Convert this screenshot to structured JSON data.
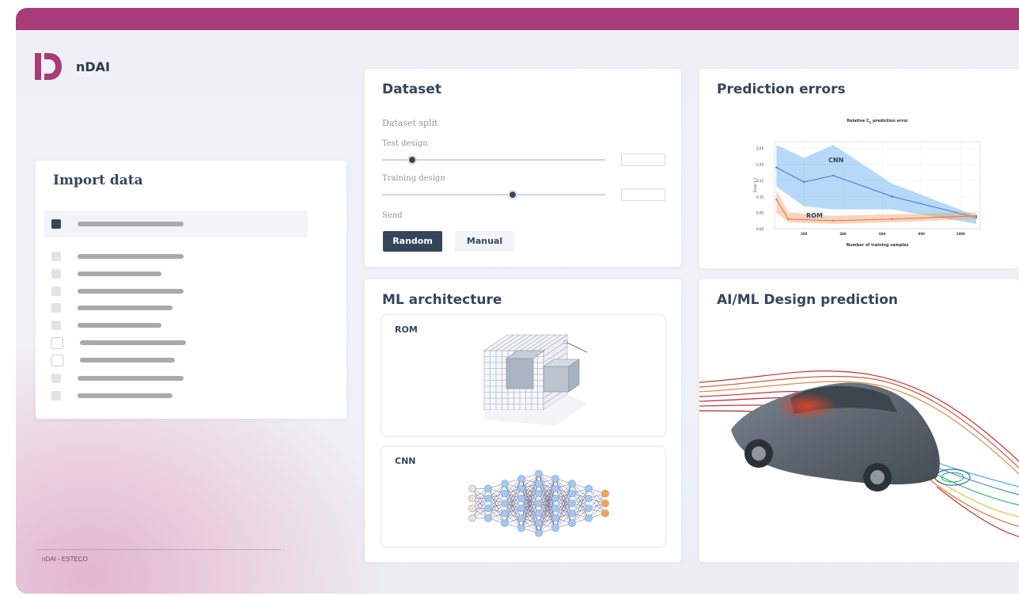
{
  "app": {
    "name": "nDAI",
    "footer": "nDAI - ESTECO"
  },
  "colors": {
    "accent_bar": "#a93b79",
    "primary": "#34465a",
    "cnn_series": "#3f78c4",
    "rom_series": "#e07a3c"
  },
  "import_data": {
    "title": "Import data",
    "items": [
      {
        "state": "checked",
        "bar": 134
      },
      {
        "state": "light",
        "bar": 134
      },
      {
        "state": "light",
        "bar": 106
      },
      {
        "state": "light",
        "bar": 134
      },
      {
        "state": "light",
        "bar": 120
      },
      {
        "state": "light",
        "bar": 106
      },
      {
        "state": "empty",
        "bar": 134
      },
      {
        "state": "empty",
        "bar": 120
      },
      {
        "state": "light",
        "bar": 134
      },
      {
        "state": "light",
        "bar": 120
      }
    ]
  },
  "dataset": {
    "title": "Dataset",
    "split_label": "Dataset split",
    "test_label": "Test design",
    "test_value": 0.13,
    "training_label": "Training design",
    "training_value": 0.58,
    "send_label": "Send",
    "random_button": "Random",
    "manual_button": "Manual"
  },
  "prediction_errors": {
    "title": "Prediction errors",
    "chart_data": {
      "type": "line",
      "title": "Relative C",
      "title_subscript": "p",
      "title_suffix": "prediction error",
      "xlabel": "Number of training samples",
      "ylabel": "Error [-]",
      "xlim": [
        50,
        1100
      ],
      "ylim": [
        0.0,
        0.27
      ],
      "x_ticks": [
        "200",
        "400",
        "600",
        "800",
        "1000"
      ],
      "y_ticks": [
        "0.00",
        "0.05",
        "0.10",
        "0.15",
        "0.20",
        "0.25"
      ],
      "grid": true,
      "annotations": [
        "CNN",
        "ROM"
      ],
      "series": [
        {
          "name": "CNN",
          "x": [
            60,
            200,
            350,
            650,
            1080
          ],
          "y": [
            0.19,
            0.145,
            0.165,
            0.1,
            0.035
          ],
          "upper": [
            0.26,
            0.22,
            0.26,
            0.14,
            0.04
          ],
          "lower": [
            0.13,
            0.07,
            0.06,
            0.06,
            0.015
          ]
        },
        {
          "name": "ROM",
          "x": [
            60,
            120,
            350,
            650,
            1080
          ],
          "y": [
            0.09,
            0.03,
            0.025,
            0.03,
            0.04
          ],
          "upper": [
            0.12,
            0.05,
            0.04,
            0.045,
            0.05
          ],
          "lower": [
            0.05,
            0.02,
            0.015,
            0.02,
            0.03
          ]
        }
      ]
    }
  },
  "ml_architecture": {
    "title": "ML architecture",
    "rom_label": "ROM",
    "cnn_label": "CNN"
  },
  "design_prediction": {
    "title": "AI/ML Design prediction"
  }
}
